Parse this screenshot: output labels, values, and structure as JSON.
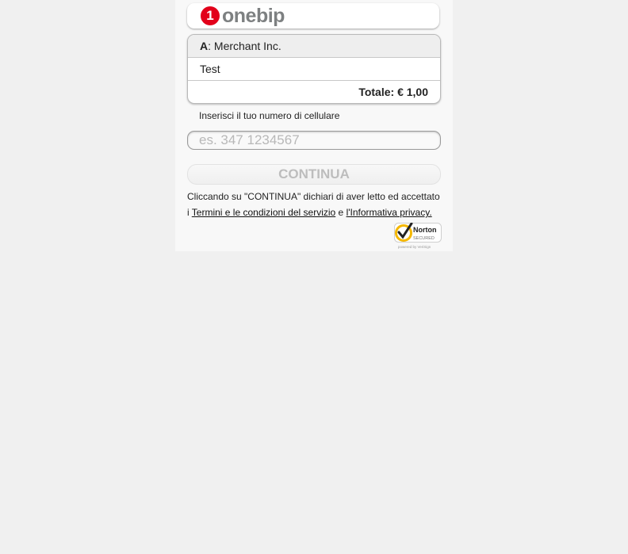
{
  "brand": {
    "logo_numeral": "1",
    "logo_text": "onebip",
    "logo_color": "#e2001a"
  },
  "summary": {
    "merchant_prefix": "A",
    "merchant_name": ": Merchant Inc.",
    "product": "Test",
    "total": "Totale: € 1,00"
  },
  "phone": {
    "label": "Inserisci il tuo numero di cellulare",
    "value": "",
    "placeholder": "es. 347 1234567"
  },
  "actions": {
    "continue_label": "CONTINUA"
  },
  "legal": {
    "text_before": "Cliccando su \"CONTINUA\" dichiari di aver letto ed accettato i ",
    "terms_link": "Termini e le condizioni del servizio",
    "text_middle": " e ",
    "privacy_link": "l'Informativa privacy."
  },
  "badge": {
    "title": "Norton",
    "subtitle": "SECURED",
    "powered": "powered by VeriSign",
    "check_color": "#f5b800"
  }
}
